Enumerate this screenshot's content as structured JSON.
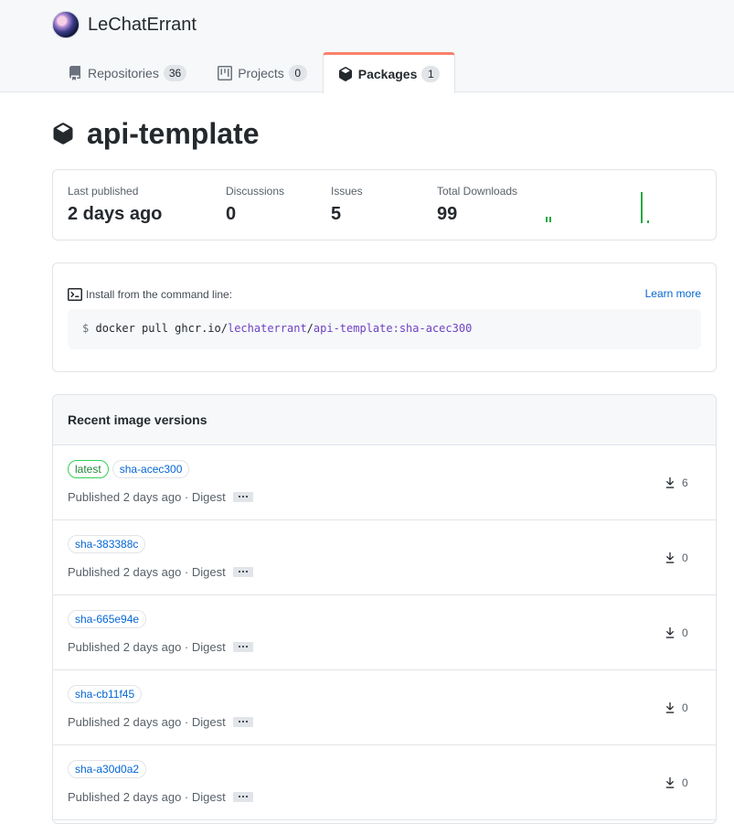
{
  "org": {
    "name": "LeChatErrant"
  },
  "tabs": [
    {
      "label": "Repositories",
      "count": "36",
      "icon": "repo-icon",
      "selected": false
    },
    {
      "label": "Projects",
      "count": "0",
      "icon": "project-icon",
      "selected": false
    },
    {
      "label": "Packages",
      "count": "1",
      "icon": "package-icon",
      "selected": true
    }
  ],
  "package": {
    "name": "api-template"
  },
  "stats": {
    "last_published_label": "Last published",
    "last_published_value": "2 days ago",
    "discussions_label": "Discussions",
    "discussions_value": "0",
    "issues_label": "Issues",
    "issues_value": "5",
    "downloads_label": "Total Downloads",
    "downloads_value": "99",
    "sparkline_color": "#28a745"
  },
  "install": {
    "label": "Install from the command line:",
    "learn_more": "Learn more",
    "prompt": "$",
    "cmd_prefix": "docker pull ghcr.io/",
    "cmd_owner": "lechaterrant",
    "cmd_sep": "/",
    "cmd_image": "api-template:sha-acec300"
  },
  "versions": {
    "title": "Recent image versions",
    "rows": [
      {
        "tags": [
          "latest",
          "sha-acec300"
        ],
        "published": "Published 2 days ago · Digest",
        "downloads": "6"
      },
      {
        "tags": [
          "sha-383388c"
        ],
        "published": "Published 2 days ago · Digest",
        "downloads": "0"
      },
      {
        "tags": [
          "sha-665e94e"
        ],
        "published": "Published 2 days ago · Digest",
        "downloads": "0"
      },
      {
        "tags": [
          "sha-cb11f45"
        ],
        "published": "Published 2 days ago · Digest",
        "downloads": "0"
      },
      {
        "tags": [
          "sha-a30d0a2"
        ],
        "published": "Published 2 days ago · Digest",
        "downloads": "0"
      }
    ]
  },
  "colors": {
    "accent": "#0366d6",
    "tab_underline": "#f9826c",
    "latest_tag": "#22863a"
  }
}
